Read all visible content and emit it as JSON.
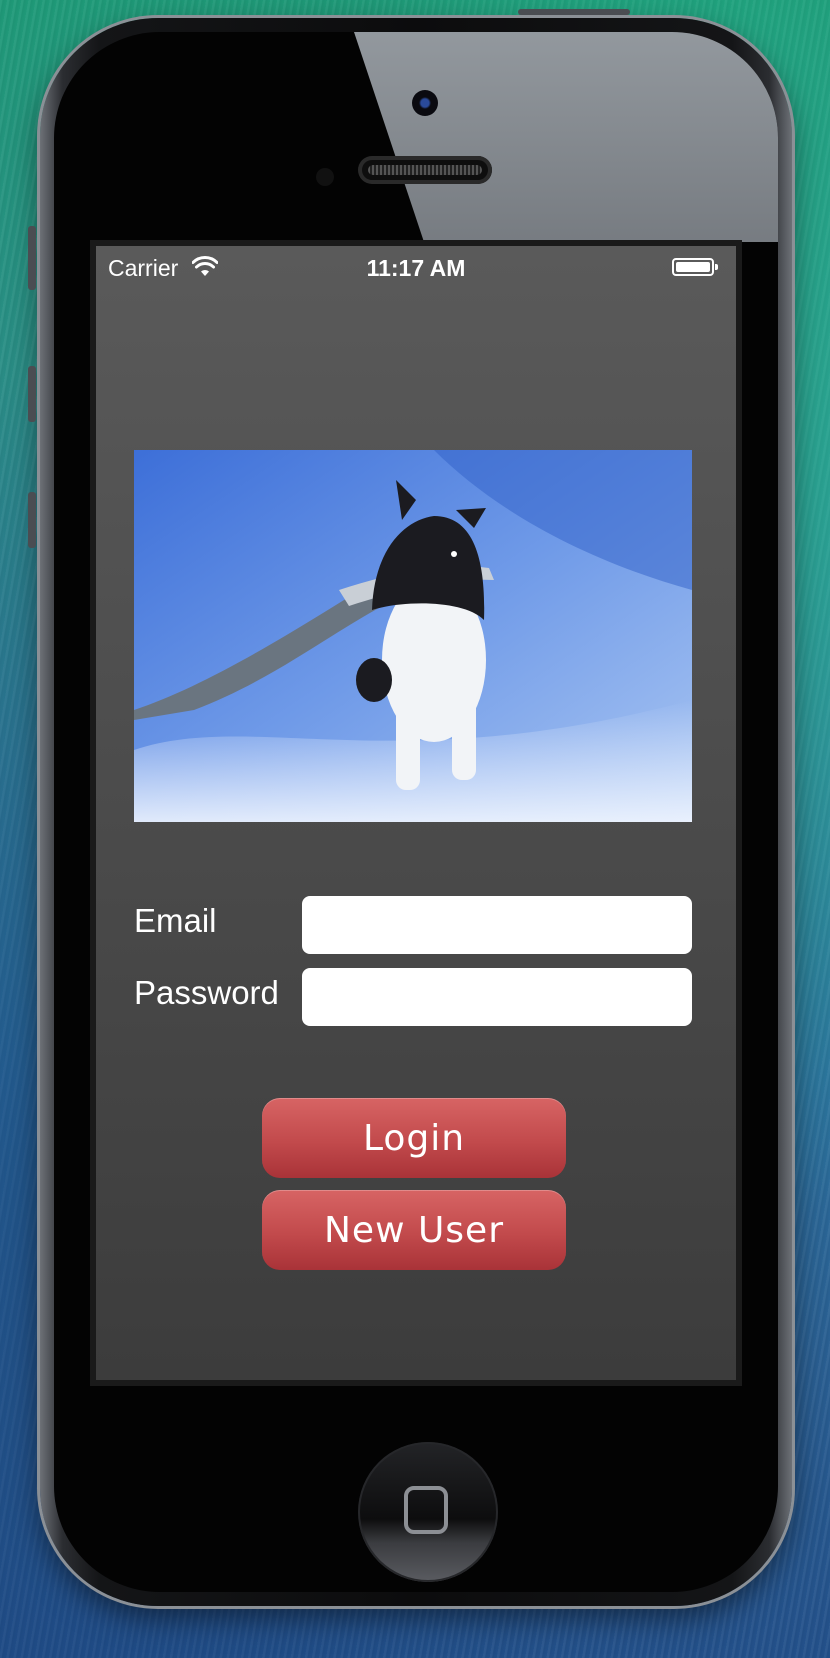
{
  "status_bar": {
    "carrier": "Carrier",
    "time": "11:17 AM",
    "wifi_icon": "wifi-icon",
    "battery_icon": "battery-icon",
    "battery_level": 1.0
  },
  "hero_image": {
    "alt": "Dog carrying a stick through snow"
  },
  "login_form": {
    "email_label": "Email",
    "email_value": "",
    "email_placeholder": "",
    "password_label": "Password",
    "password_value": "",
    "password_placeholder": ""
  },
  "buttons": {
    "login_label": "Login",
    "new_user_label": "New User"
  },
  "colors": {
    "button_red": "#c24a4c",
    "screen_background": "#4b4b4b"
  }
}
